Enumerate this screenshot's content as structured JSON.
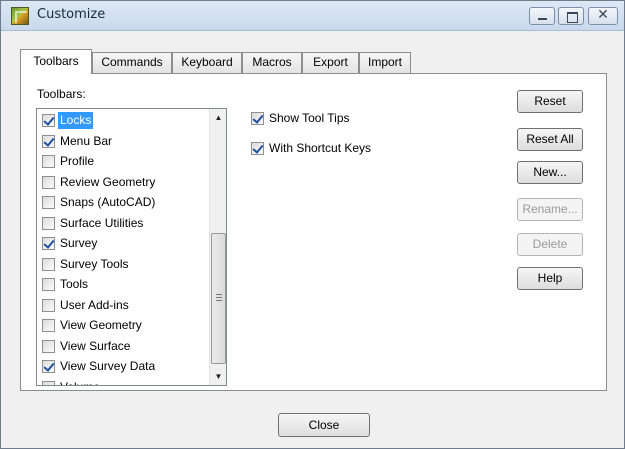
{
  "window": {
    "title": "Customize"
  },
  "tabs": [
    {
      "label": "Toolbars"
    },
    {
      "label": "Commands"
    },
    {
      "label": "Keyboard"
    },
    {
      "label": "Macros"
    },
    {
      "label": "Export"
    },
    {
      "label": "Import"
    }
  ],
  "toolbars": {
    "label": "Toolbars:",
    "items": [
      {
        "label": "Locks",
        "checked": true,
        "selected": true
      },
      {
        "label": "Menu Bar",
        "checked": true
      },
      {
        "label": "Profile",
        "checked": false
      },
      {
        "label": "Review Geometry",
        "checked": false
      },
      {
        "label": "Snaps (AutoCAD)",
        "checked": false
      },
      {
        "label": "Surface Utilities",
        "checked": false
      },
      {
        "label": "Survey",
        "checked": true
      },
      {
        "label": "Survey Tools",
        "checked": false
      },
      {
        "label": "Tools",
        "checked": false
      },
      {
        "label": "User Add-ins",
        "checked": false
      },
      {
        "label": "View Geometry",
        "checked": false
      },
      {
        "label": "View Surface",
        "checked": false
      },
      {
        "label": "View Survey Data",
        "checked": true
      },
      {
        "label": "Volume",
        "checked": false
      }
    ]
  },
  "options": {
    "show_tool_tips": {
      "label": "Show Tool Tips",
      "checked": true
    },
    "with_shortcut_keys": {
      "label": "With Shortcut Keys",
      "checked": true
    }
  },
  "buttons": {
    "reset": "Reset",
    "reset_all": "Reset All",
    "new": "New...",
    "rename": "Rename...",
    "delete": "Delete",
    "help": "Help",
    "close": "Close"
  },
  "colors": {
    "selection": "#3399ff",
    "check": "#1f4fa3"
  }
}
